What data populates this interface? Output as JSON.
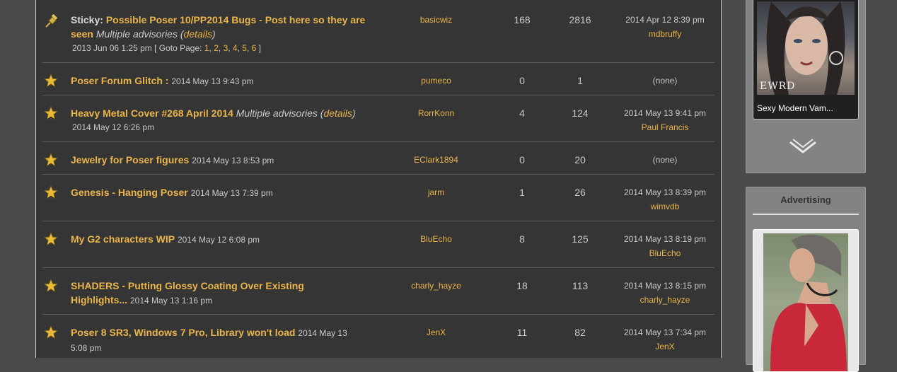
{
  "topics": [
    {
      "sticky_label": "Sticky:",
      "title": "Possible Poser 10/PP2014 Bugs - Post here so they are seen",
      "advisory_text": "Multiple advisories (",
      "advisory_link": "details",
      "advisory_end": ")",
      "date": "2013 Jun 06 1:25 pm",
      "goto_prefix": "[ Goto Page:",
      "pages": [
        "1",
        "2",
        "3",
        "4",
        "5",
        "6"
      ],
      "goto_suffix": "]",
      "author": "basicwiz",
      "replies": "168",
      "views": "2816",
      "last_date": "2014 Apr 12 8:39 pm",
      "last_user": "mdbruffy"
    },
    {
      "title": "Poser Forum Glitch :",
      "date": "2014 May 13 9:43 pm",
      "author": "pumeco",
      "replies": "0",
      "views": "1",
      "last_date": "(none)",
      "last_user": ""
    },
    {
      "title": "Heavy Metal Cover #268 April 2014",
      "advisory_text": "Multiple advisories (",
      "advisory_link": "details",
      "advisory_end": ")",
      "date": "2014 May 12 6:26 pm",
      "author": "RorrKonn",
      "replies": "4",
      "views": "124",
      "last_date": "2014 May 13 9:41 pm",
      "last_user": "Paul Francis"
    },
    {
      "title": "Jewelry for Poser figures",
      "date": "2014 May 13 8:53 pm",
      "author": "EClark1894",
      "replies": "0",
      "views": "20",
      "last_date": "(none)",
      "last_user": ""
    },
    {
      "title": "Genesis - Hanging Poser",
      "date": "2014 May 13 7:39 pm",
      "author": "jarm",
      "replies": "1",
      "views": "26",
      "last_date": "2014 May 13 8:39 pm",
      "last_user": "wimvdb"
    },
    {
      "title": "My G2 characters WIP",
      "date": "2014 May 12 6:08 pm",
      "author": "BluEcho",
      "replies": "8",
      "views": "125",
      "last_date": "2014 May 13 8:19 pm",
      "last_user": "BluEcho"
    },
    {
      "title": "SHADERS - Putting Glossy Coating Over Existing Highlights...",
      "date": "2014 May 13 1:16 pm",
      "author": "charly_hayze",
      "replies": "18",
      "views": "113",
      "last_date": "2014 May 13 8:15 pm",
      "last_user": "charly_hayze"
    },
    {
      "title": "Poser 8 SR3, Windows 7 Pro, Library won't load",
      "date": "2014 May 13 5:08 pm",
      "author": "JenX",
      "replies": "11",
      "views": "82",
      "last_date": "2014 May 13 7:34 pm",
      "last_user": "JenX"
    }
  ],
  "sidebar": {
    "product_caption": "Sexy Modern Vam...",
    "product_logo_text": "EWRD",
    "ad_heading": "Advertising"
  },
  "icons": {
    "sticky": "pushpin-icon",
    "topic": "star-icon",
    "scroll": "chevron-down-icon"
  },
  "colors": {
    "link": "#eab54a",
    "panel_bg": "#353535",
    "page_bg": "#4a4a4a"
  }
}
